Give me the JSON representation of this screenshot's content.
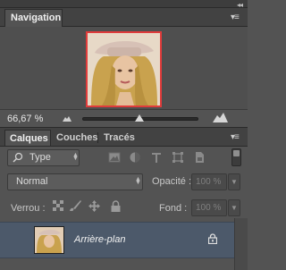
{
  "navigator": {
    "tab_label": "Navigation",
    "zoom_value": "66,67 %",
    "zoom_slider_fraction": 0.49
  },
  "layers_panel": {
    "tabs": [
      {
        "label": "Calques",
        "active": true
      },
      {
        "label": "Couches",
        "active": false
      },
      {
        "label": "Tracés",
        "active": false
      }
    ],
    "filter": {
      "label": "Type",
      "icons": [
        "pixel-filter-icon",
        "adjustment-filter-icon",
        "type-filter-icon",
        "shape-filter-icon",
        "smart-object-filter-icon"
      ]
    },
    "blend_mode": "Normal",
    "opacity_label": "Opacité :",
    "opacity_value": "100 %",
    "lock_label": "Verrou :",
    "lock_icons": [
      "lock-transparency-icon",
      "lock-pixels-icon",
      "lock-position-icon",
      "lock-all-icon"
    ],
    "fill_label": "Fond :",
    "fill_value": "100 %",
    "layers": [
      {
        "name": "Arrière-plan",
        "visible": true,
        "locked": true
      }
    ]
  },
  "colors": {
    "panel_bg": "#535353",
    "tab_bar_bg": "#424242",
    "selected_layer_bg": "#4c596a",
    "navigator_proxy_border": "#e03b3b"
  }
}
